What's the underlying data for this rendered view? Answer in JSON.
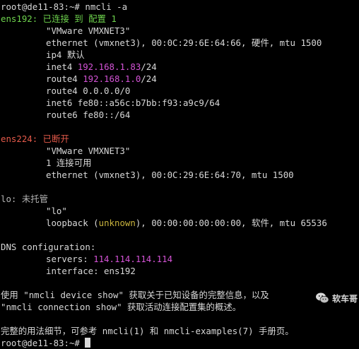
{
  "colors": {
    "background": "#000000",
    "text": "#d8d8d8",
    "connected_green": "#6ed34d",
    "disconnected_red": "#e55a4a",
    "address_magenta": "#d453d6",
    "unmanaged_gray": "#b5b5b5",
    "unknown_yellow": "#c9b33d"
  },
  "prompt": {
    "text": "root@de11-83:~# ",
    "command": "nmcli -a"
  },
  "ens192": {
    "header": "ens192: 已连接 到 配置 1",
    "name": "\"VMware VMXNET3\"",
    "hw": "ethernet (vmxnet3), 00:0C:29:6E:64:66, 硬件, mtu 1500",
    "ip4_default": "ip4 默认",
    "inet4_label": "inet4 ",
    "inet4_value": "192.168.1.83",
    "inet4_suffix": "/24",
    "route4_1_label": "route4 ",
    "route4_1_value": "192.168.1.0",
    "route4_1_suffix": "/24",
    "route4_2": "route4 0.0.0.0/0",
    "inet6": "inet6 fe80::a56c:b7bb:f93:a9c9/64",
    "route6": "route6 fe80::/64"
  },
  "ens224": {
    "header": "ens224: 已断开",
    "name": "\"VMware VMXNET3\"",
    "available": "1 连接可用",
    "hw": "ethernet (vmxnet3), 00:0C:29:6E:64:70, mtu 1500"
  },
  "lo": {
    "header": "lo: 未托管",
    "name": "\"lo\"",
    "hw_prefix": "loopback (",
    "hw_unknown": "unknown",
    "hw_suffix": "), 00:00:00:00:00:00, 软件, mtu 65536"
  },
  "dns": {
    "header": "DNS configuration:",
    "servers_label": "servers: ",
    "servers_value": "114.114.114.114",
    "interface": "interface: ens192"
  },
  "help": {
    "line1": "使用 \"nmcli device show\" 获取关于已知设备的完整信息，以及",
    "line2": "\"nmcli connection show\" 获取活动连接配置集的概述。",
    "line3": "完整的用法细节，可参考 nmcli(1) 和 nmcli-examples(7) 手册页。"
  },
  "final_prompt": "root@de11-83:~# ",
  "watermark": {
    "icon": "wechat-icon",
    "text": "软车哥"
  }
}
